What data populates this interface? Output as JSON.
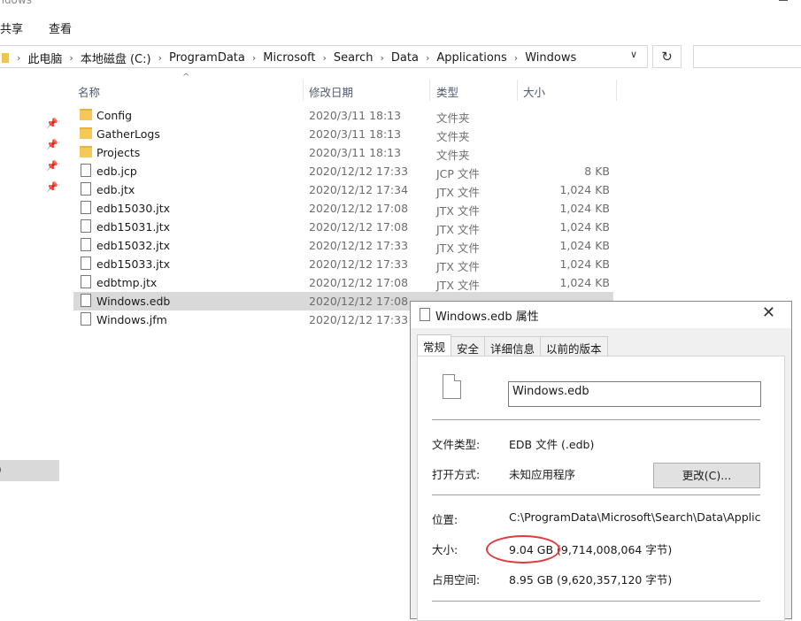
{
  "window": {
    "title_partial": "indows"
  },
  "ribbon": {
    "tabs": [
      "共享",
      "查看"
    ]
  },
  "address": {
    "crumbs": [
      "此电脑",
      "本地磁盘 (C:)",
      "ProgramData",
      "Microsoft",
      "Search",
      "Data",
      "Applications",
      "Windows"
    ],
    "dropdown_icon": "chevron-down-icon",
    "refresh_icon": "refresh-icon",
    "refresh_glyph": "↻",
    "dropdown_glyph": "∨"
  },
  "columns": {
    "name": "名称",
    "date": "修改日期",
    "type": "类型",
    "size": "大小"
  },
  "left_pane": {
    "selected_partial": ")"
  },
  "files": [
    {
      "name": "Config",
      "date": "2020/3/11 18:13",
      "type": "文件夹",
      "size": "",
      "kind": "folder"
    },
    {
      "name": "GatherLogs",
      "date": "2020/3/11 18:13",
      "type": "文件夹",
      "size": "",
      "kind": "folder"
    },
    {
      "name": "Projects",
      "date": "2020/3/11 18:13",
      "type": "文件夹",
      "size": "",
      "kind": "folder"
    },
    {
      "name": "edb.jcp",
      "date": "2020/12/12 17:33",
      "type": "JCP 文件",
      "size": "8 KB",
      "kind": "file"
    },
    {
      "name": "edb.jtx",
      "date": "2020/12/12 17:34",
      "type": "JTX 文件",
      "size": "1,024 KB",
      "kind": "file"
    },
    {
      "name": "edb15030.jtx",
      "date": "2020/12/12 17:08",
      "type": "JTX 文件",
      "size": "1,024 KB",
      "kind": "file"
    },
    {
      "name": "edb15031.jtx",
      "date": "2020/12/12 17:08",
      "type": "JTX 文件",
      "size": "1,024 KB",
      "kind": "file"
    },
    {
      "name": "edb15032.jtx",
      "date": "2020/12/12 17:33",
      "type": "JTX 文件",
      "size": "1,024 KB",
      "kind": "file"
    },
    {
      "name": "edb15033.jtx",
      "date": "2020/12/12 17:33",
      "type": "JTX 文件",
      "size": "1,024 KB",
      "kind": "file"
    },
    {
      "name": "edbtmp.jtx",
      "date": "2020/12/12 17:08",
      "type": "JTX 文件",
      "size": "1,024 KB",
      "kind": "file"
    },
    {
      "name": "Windows.edb",
      "date": "2020/12/12 17:08",
      "type": "",
      "size": "",
      "kind": "file",
      "selected": true
    },
    {
      "name": "Windows.jfm",
      "date": "2020/12/12 17:33",
      "type": "",
      "size": "",
      "kind": "file"
    }
  ],
  "dialog": {
    "title": "Windows.edb 属性",
    "close_glyph": "✕",
    "tabs": [
      "常规",
      "安全",
      "详细信息",
      "以前的版本"
    ],
    "filename": "Windows.edb",
    "file_type_label": "文件类型:",
    "file_type_value": "EDB 文件 (.edb)",
    "opens_with_label": "打开方式:",
    "opens_with_value": "未知应用程序",
    "change_button": "更改(C)...",
    "location_label": "位置:",
    "location_value": "C:\\ProgramData\\Microsoft\\Search\\Data\\Applicati",
    "size_label": "大小:",
    "size_value": "9.04 GB (9,714,008,064 字节)",
    "size_on_disk_label": "占用空间:",
    "size_on_disk_value": "8.95 GB (9,620,357,120 字节)"
  },
  "colors": {
    "highlight_circle": "#e03c3c",
    "selection": "#d9d9d9",
    "folder": "#f4c95a"
  }
}
